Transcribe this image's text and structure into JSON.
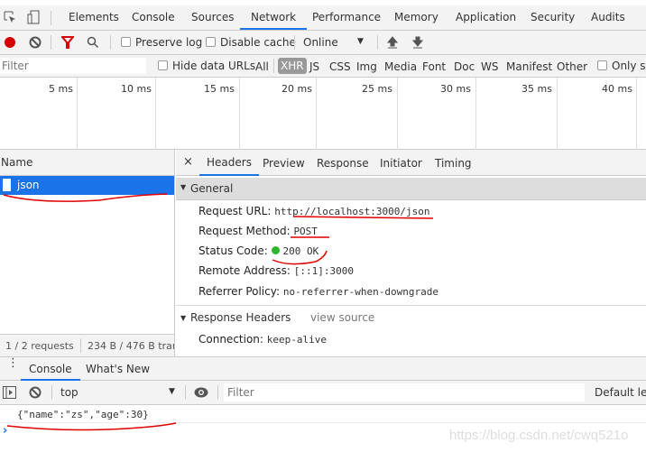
{
  "main_tabs": [
    "Elements",
    "Console",
    "Sources",
    "Network",
    "Performance",
    "Memory",
    "Application",
    "Security",
    "Audits"
  ],
  "active_tab": "Network",
  "toolbar": {
    "preserve_log": "Preserve log",
    "disable_cache": "Disable cache",
    "throttle": "Online"
  },
  "filter": {
    "placeholder": "Filter",
    "hide_data_urls": "Hide data URLs",
    "types": [
      "All",
      "XHR",
      "JS",
      "CSS",
      "Img",
      "Media",
      "Font",
      "Doc",
      "WS",
      "Manifest",
      "Other"
    ],
    "active_type": "XHR",
    "only_show": "Only sh"
  },
  "timeline": {
    "ticks": [
      "5 ms",
      "10 ms",
      "15 ms",
      "20 ms",
      "25 ms",
      "30 ms",
      "35 ms",
      "40 ms"
    ]
  },
  "requests": {
    "column": "Name",
    "items": [
      {
        "name": "json",
        "selected": true
      }
    ],
    "status": "1 / 2 requests",
    "transfer": "234 B / 476 B tran"
  },
  "details": {
    "tabs": [
      "Headers",
      "Preview",
      "Response",
      "Initiator",
      "Timing"
    ],
    "active": "Headers",
    "close": "×",
    "general_title": "General",
    "general": [
      {
        "label": "Request URL:",
        "value": "http://localhost:3000/json"
      },
      {
        "label": "Request Method:",
        "value": "POST"
      },
      {
        "label": "Status Code:",
        "value": "200 OK",
        "status_color": "#2db72d"
      },
      {
        "label": "Remote Address:",
        "value": "[::1]:3000"
      },
      {
        "label": "Referrer Policy:",
        "value": "no-referrer-when-downgrade"
      }
    ],
    "response_headers_title": "Response Headers",
    "view_source": "view source",
    "response_headers": [
      {
        "label": "Connection:",
        "value": "keep-alive"
      }
    ]
  },
  "drawer": {
    "tabs": [
      "Console",
      "What's New"
    ],
    "active": "Console",
    "context": "top",
    "filter_placeholder": "Filter",
    "levels": "Default lev",
    "output": "{\"name\":\"zs\",\"age\":30}",
    "prompt": "›"
  },
  "watermark": "https://blog.csdn.net/cwq521o",
  "colors": {
    "accent": "#1a73e8",
    "selected_row": "#1a73e8",
    "record": "#d50000",
    "filter_icon": "#d50000",
    "annotation": "#e00000"
  }
}
